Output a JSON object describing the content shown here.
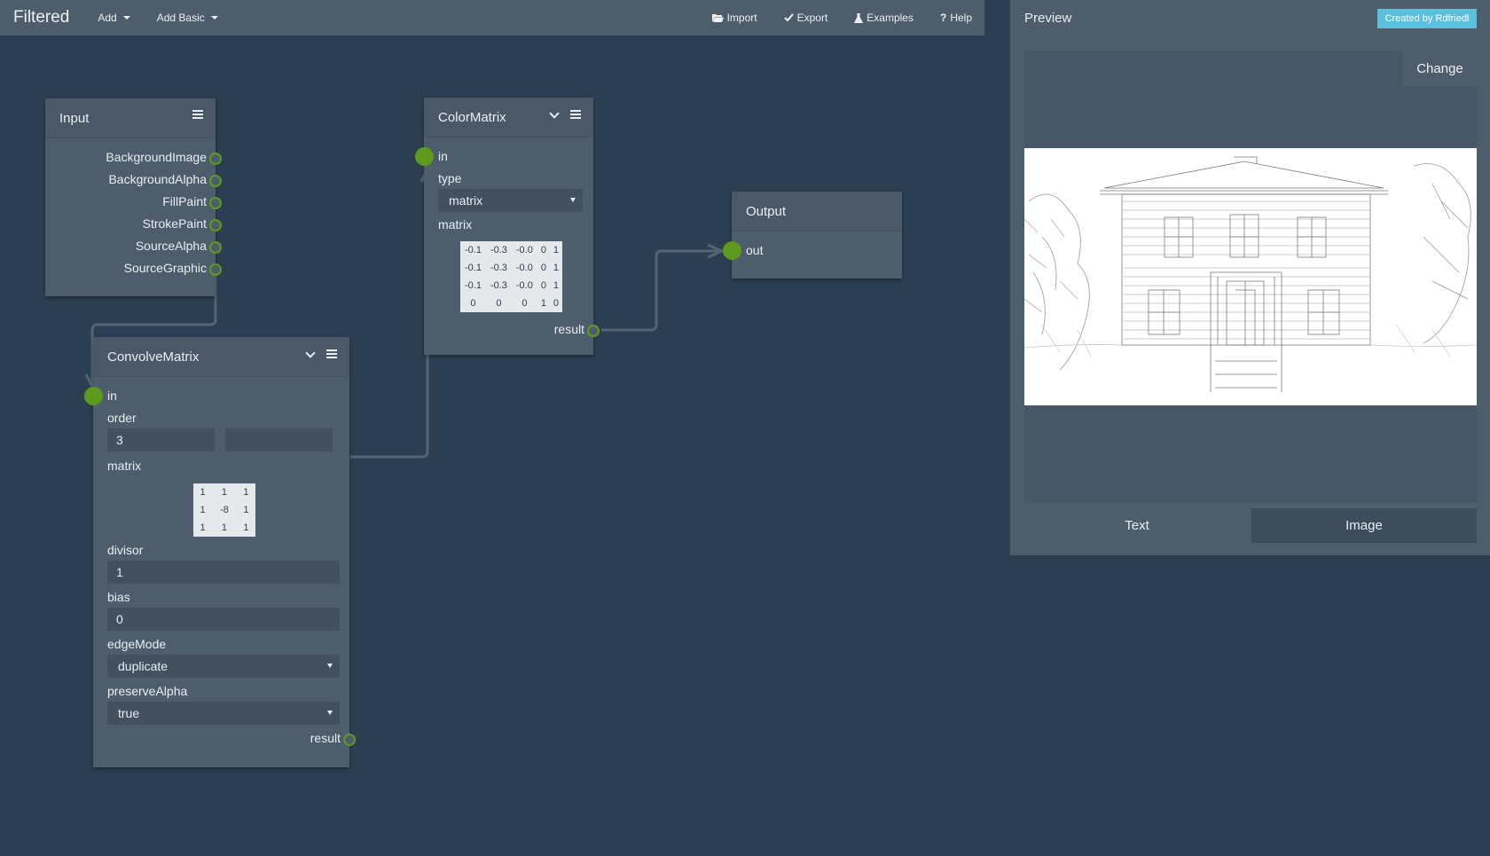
{
  "app": {
    "title": "Filtered"
  },
  "menu": {
    "add": "Add",
    "add_basic": "Add Basic",
    "import": "Import",
    "export": "Export",
    "examples": "Examples",
    "help": "Help"
  },
  "icons": {
    "import": "folder-open-icon",
    "export": "check-icon",
    "examples": "flask-icon",
    "help": "question-icon"
  },
  "colors": {
    "port_green": "#5e9a1b",
    "created_badge": "#5bc0de",
    "node_bg": "#4e5d6c",
    "workspace_bg": "#2c3e51"
  },
  "input_node": {
    "title": "Input",
    "outputs": [
      "BackgroundImage",
      "BackgroundAlpha",
      "FillPaint",
      "StrokePaint",
      "SourceAlpha",
      "SourceGraphic"
    ]
  },
  "colormatrix_node": {
    "title": "ColorMatrix",
    "in_label": "in",
    "type_label": "type",
    "type_value": "matrix",
    "matrix_label": "matrix",
    "matrix": [
      [
        "-0.1",
        "-0.3",
        "-0.0",
        "0",
        "1"
      ],
      [
        "-0.1",
        "-0.3",
        "-0.0",
        "0",
        "1"
      ],
      [
        "-0.1",
        "-0.3",
        "-0.0",
        "0",
        "1"
      ],
      [
        "0",
        "0",
        "0",
        "1",
        "0"
      ]
    ],
    "result_label": "result"
  },
  "output_node": {
    "title": "Output",
    "out_label": "out"
  },
  "convolve_node": {
    "title": "ConvolveMatrix",
    "in_label": "in",
    "order_label": "order",
    "order_value": "3",
    "order_value2": "",
    "matrix_label": "matrix",
    "matrix": [
      [
        "1",
        "1",
        "1"
      ],
      [
        "1",
        "-8",
        "1"
      ],
      [
        "1",
        "1",
        "1"
      ]
    ],
    "divisor_label": "divisor",
    "divisor_value": "1",
    "bias_label": "bias",
    "bias_value": "0",
    "edgemode_label": "edgeMode",
    "edgemode_value": "duplicate",
    "preservealpha_label": "preserveAlpha",
    "preservealpha_value": "true",
    "result_label": "result"
  },
  "preview": {
    "title": "Preview",
    "created_by": "Created by Rdfriedl",
    "change": "Change",
    "tabs": [
      "Text",
      "Image"
    ],
    "active_tab": "Image"
  }
}
